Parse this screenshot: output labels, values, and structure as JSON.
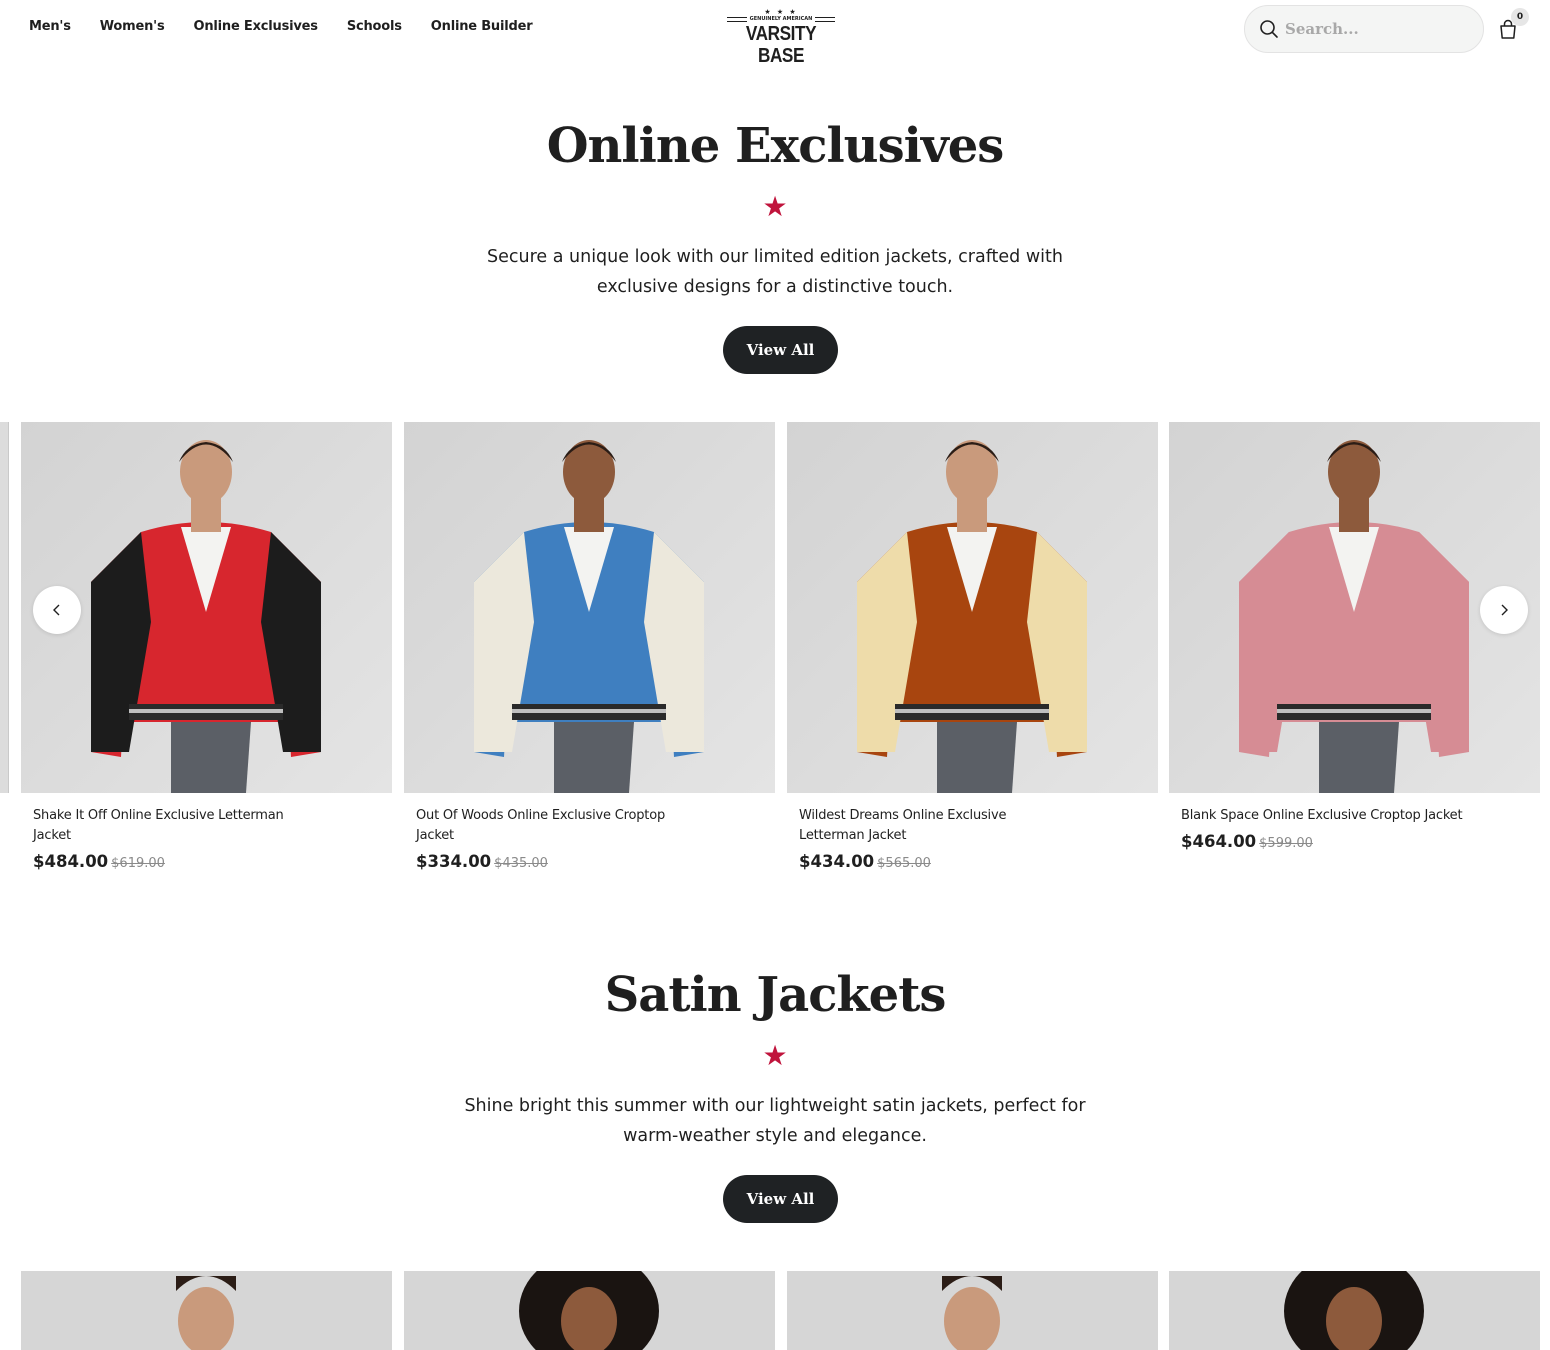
{
  "header": {
    "nav": [
      "Men's",
      "Women's",
      "Online Exclusives",
      "Schools",
      "Online Builder"
    ],
    "logo": {
      "stars": "★ ★ ★",
      "tagline": "GENUINELY AMERICAN",
      "wordmark": "VARSITY BASE"
    },
    "search": {
      "placeholder": "Search..."
    },
    "cart": {
      "count": "0"
    }
  },
  "online_exclusives": {
    "title": "Online Exclusives",
    "star": "★",
    "description_line1": "Secure a unique look with our limited edition jackets, crafted with",
    "description_line2": "exclusive designs for a distinctive touch.",
    "button": "View All",
    "products": [
      {
        "name": "Shake It Off Online Exclusive Letterman Jacket",
        "price": "$484.00",
        "old_price": "$619.00",
        "body": "#d7262e",
        "sleeves": "#1c1c1c",
        "skin": "#c99a7c"
      },
      {
        "name": "Out Of Woods Online Exclusive Croptop Jacket",
        "price": "$334.00",
        "old_price": "$435.00",
        "body": "#3f7fc0",
        "sleeves": "#ece8dc",
        "skin": "#8d5a3c"
      },
      {
        "name": "Wildest Dreams Online Exclusive Letterman Jacket",
        "price": "$434.00",
        "old_price": "$565.00",
        "body": "#a8450f",
        "sleeves": "#eedcaa",
        "skin": "#c99a7c"
      },
      {
        "name": "Blank Space Online Exclusive Croptop Jacket",
        "price": "$464.00",
        "old_price": "$599.00",
        "body": "#d68c94",
        "sleeves": "#d68c94",
        "skin": "#8d5a3c"
      }
    ]
  },
  "satin_jackets": {
    "title": "Satin Jackets",
    "star": "★",
    "description_line1": "Shine bright this summer with our lightweight satin jackets, perfect for",
    "description_line2": "warm-weather style and elegance.",
    "button": "View All"
  },
  "colors": {
    "accent_star": "#c0143c",
    "button_bg": "#1f2224",
    "text": "#1f1f1f"
  }
}
